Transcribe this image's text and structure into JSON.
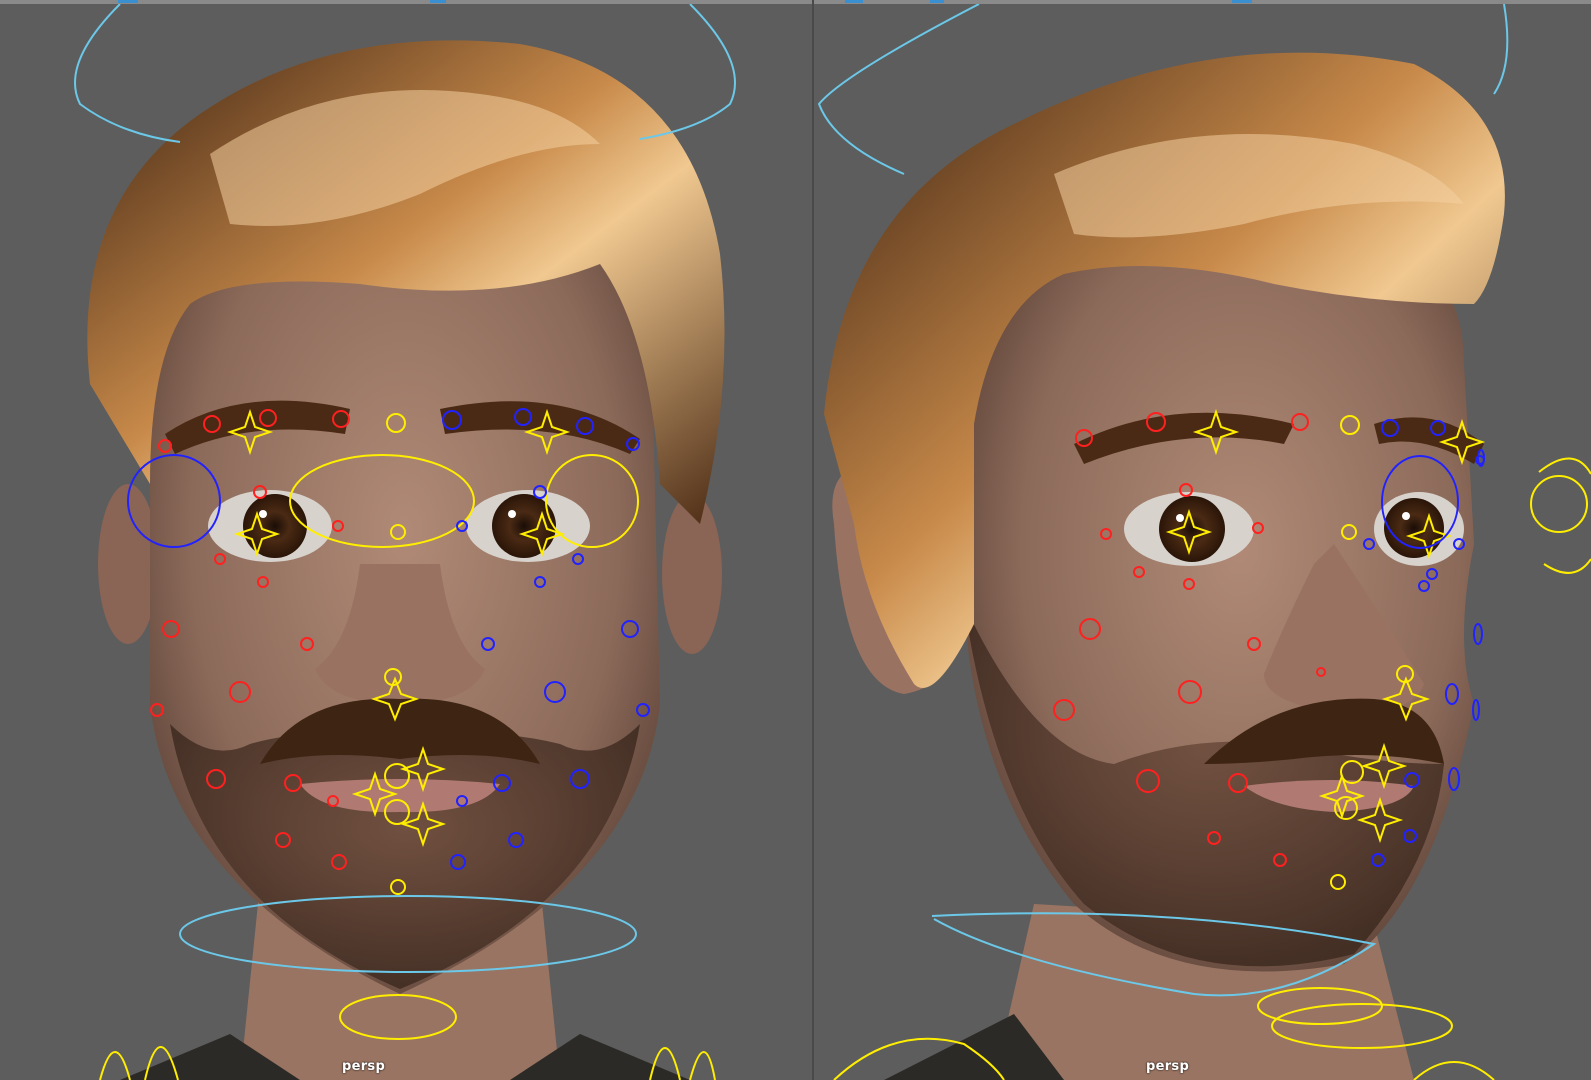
{
  "viewports": [
    {
      "id": "left",
      "camera_label": "persp"
    },
    {
      "id": "right",
      "camera_label": "persp"
    }
  ],
  "colors": {
    "viewport_bg": "#5d5d5d",
    "control_left": "#ff2020",
    "control_right": "#2222ff",
    "control_center": "#ffee00",
    "control_global": "#6cc8e8",
    "hair": "#5a3416",
    "skin": "#a07a66"
  },
  "icons": {
    "cam_hud": "camera-name-hud"
  }
}
